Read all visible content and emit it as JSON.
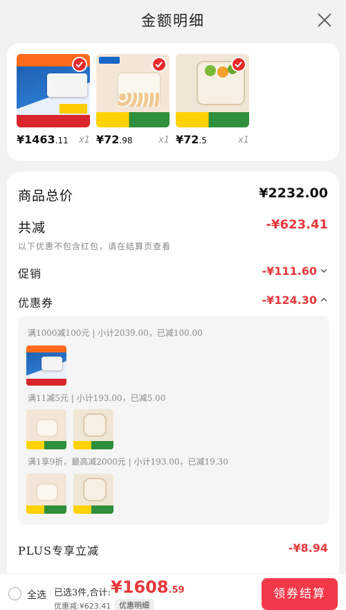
{
  "header": {
    "title": "金额明细"
  },
  "products": [
    {
      "price_main": "¥1463",
      "price_dec": ".11",
      "qty": "x1"
    },
    {
      "price_main": "¥72",
      "price_dec": ".98",
      "qty": "x1"
    },
    {
      "price_main": "¥72",
      "price_dec": ".5",
      "qty": "x1"
    }
  ],
  "summary": {
    "total_label": "商品总价",
    "total_value": "¥2232.00",
    "reduce_label": "共减",
    "reduce_value": "-¥623.41",
    "reduce_note": "以下优惠不包含红包，请在结算页查看",
    "promo_label": "促销",
    "promo_value": "-¥111.60",
    "coupon_label": "优惠券",
    "coupon_value": "-¥124.30",
    "coupons": [
      "满1000减100元 | 小计2039.00，已减100.00",
      "满11减5元 | 小计193.00，已减5.00",
      "满1享9折，最高减2000元 | 小计193.00，已减19.30"
    ],
    "plus_label": "PLUS专享立减",
    "plus_value": "-¥8.94"
  },
  "bottom": {
    "select_all": "全选",
    "selected_text": "已选3件,合计:",
    "total_main": "¥1608",
    "total_dec": ".59",
    "discount_text": "优惠减:¥623.41",
    "detail_link": "优惠明细",
    "pay_button": "领券结算"
  },
  "colors": {
    "accent": "#e4393c",
    "check": "#e62b2b",
    "button": "#f2394a"
  },
  "icons": [
    "close-icon",
    "check-icon",
    "chevron-down-icon",
    "chevron-up-icon",
    "radio-icon"
  ]
}
